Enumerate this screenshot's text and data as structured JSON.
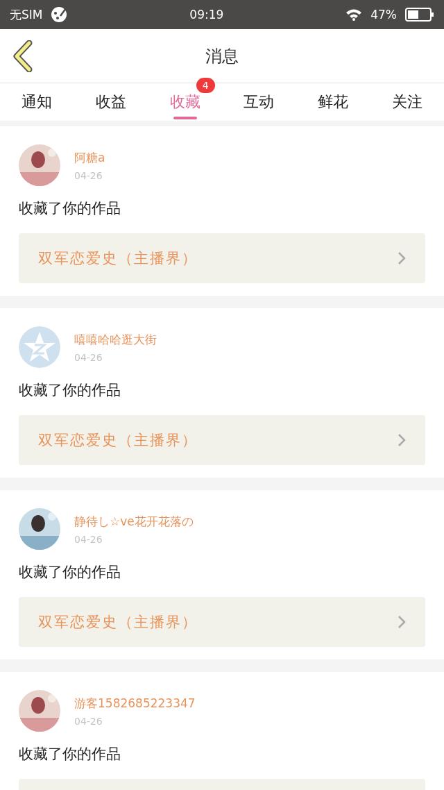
{
  "status_bar": {
    "carrier": "无SIM",
    "time": "09:19",
    "battery": "47%"
  },
  "header": {
    "title": "消息"
  },
  "tabs": [
    {
      "label": "通知",
      "selected": false
    },
    {
      "label": "收益",
      "selected": false
    },
    {
      "label": "收藏",
      "selected": true,
      "badge": "4"
    },
    {
      "label": "互动",
      "selected": false
    },
    {
      "label": "鲜花",
      "selected": false
    },
    {
      "label": "关注",
      "selected": false
    }
  ],
  "messages": [
    {
      "name": "阿糖a",
      "date": "04-26",
      "action": "收藏了你的作品",
      "work": "双军恋爱史（主播界）"
    },
    {
      "avatar": {
        "kind": "logo"
      },
      "name": "嘻嘻哈哈逛大街",
      "date": "04-26",
      "action": "收藏了你的作品",
      "work": "双军恋爱史（主播界）"
    },
    {
      "name": "静待し☆ve花开花落の",
      "date": "04-26",
      "action": "收藏了你的作品",
      "work": "双军恋爱史（主播界）"
    },
    {
      "name": "游客1582685223347",
      "date": "04-26",
      "action": "收藏了你的作品"
    }
  ]
}
